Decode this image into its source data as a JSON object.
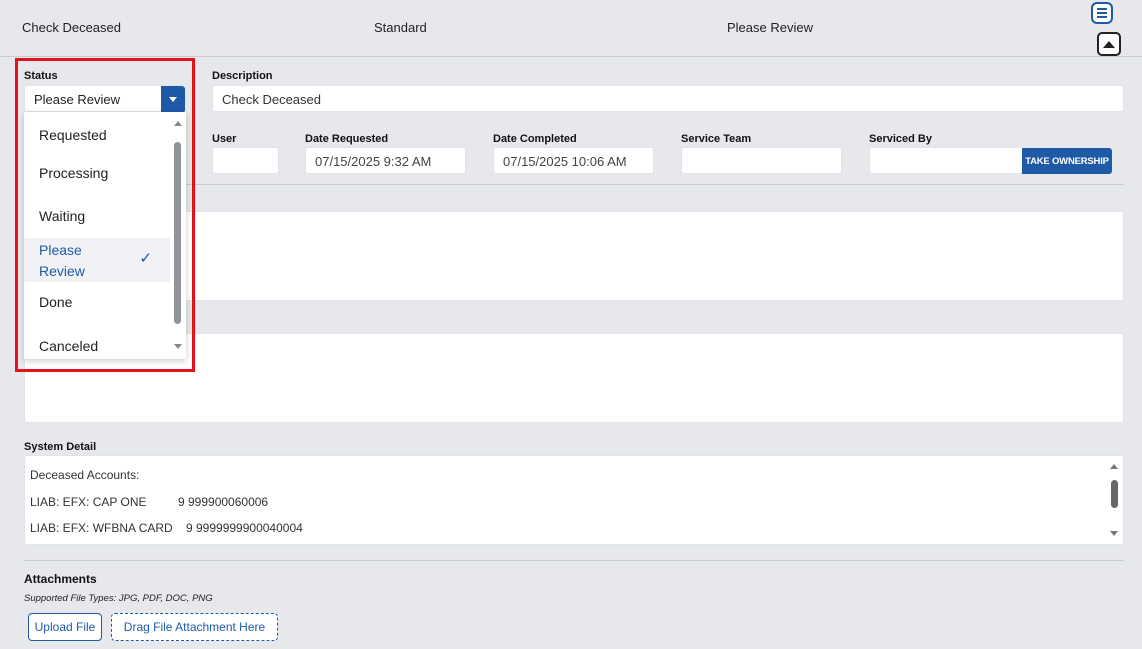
{
  "header": {
    "title": "Check Deceased",
    "type": "Standard",
    "status": "Please Review"
  },
  "status": {
    "label": "Status",
    "value": "Please Review",
    "options": [
      {
        "label": "Requested"
      },
      {
        "label": "Processing"
      },
      {
        "label": "Waiting"
      },
      {
        "label": "Please Review",
        "line1": "Please",
        "line2": "Review",
        "selected": true
      },
      {
        "label": "Done"
      },
      {
        "label": "Canceled"
      }
    ]
  },
  "description": {
    "label": "Description",
    "value": "Check Deceased"
  },
  "fields": {
    "user": {
      "label": "User",
      "value": ""
    },
    "date_requested": {
      "label": "Date Requested",
      "value": "07/15/2025 9:32 AM"
    },
    "date_completed": {
      "label": "Date Completed",
      "value": "07/15/2025 10:06 AM"
    },
    "service_team": {
      "label": "Service Team",
      "value": ""
    },
    "serviced_by": {
      "label": "Serviced By",
      "value": ""
    },
    "take_ownership": "TAKE OWNERSHIP"
  },
  "system_detail": {
    "label": "System Detail",
    "heading": "Deceased Accounts:",
    "rows": [
      {
        "name": "LIAB: EFX: CAP ONE",
        "number": "9 999900060006"
      },
      {
        "name": "LIAB: EFX: WFBNA CARD",
        "number": "9 9999999900040004"
      }
    ]
  },
  "attachments": {
    "label": "Attachments",
    "supported": "Supported File Types: JPG, PDF, DOC, PNG",
    "upload": "Upload File",
    "drag": "Drag File Attachment Here"
  },
  "colors": {
    "accent": "#1f5aa6",
    "highlight": "#e5121c",
    "background": "#e6e8ec"
  }
}
